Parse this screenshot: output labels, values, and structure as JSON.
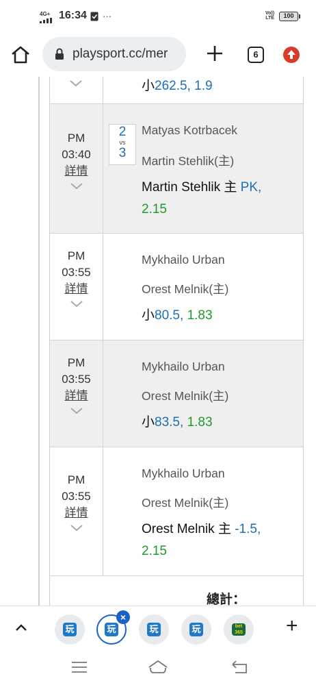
{
  "status_bar": {
    "network": "4G+",
    "time": "16:34",
    "volte": "Vo))\nLTE",
    "battery": "100",
    "more_dots": "···"
  },
  "browser": {
    "url": "playsport.cc/mer",
    "tab_count": "6"
  },
  "partial_row": {
    "bet_prefix": "小",
    "bet_line": "262.5,",
    "bet_odds": "1.9"
  },
  "matches": [
    {
      "ampm": "PM",
      "time": "03:40",
      "detail_label": "詳情",
      "score_top": "2",
      "vs_label": "vs",
      "score_bottom": "3",
      "away": "Matyas Kotrbacek",
      "home": "Martin Stehlik(主)",
      "bet_pick": "Martin Stehlik 主 ",
      "bet_line": "PK,",
      "bet_odds": "2.15",
      "colors": {
        "background": "#efefef"
      }
    },
    {
      "ampm": "PM",
      "time": "03:55",
      "detail_label": "詳情",
      "away": "Mykhailo Urban",
      "home": "Orest Melnik(主)",
      "bet_pick": "小",
      "bet_line": "80.5,",
      "bet_odds": "1.83",
      "colors": {
        "background": "#ffffff"
      }
    },
    {
      "ampm": "PM",
      "time": "03:55",
      "detail_label": "詳情",
      "away": "Mykhailo Urban",
      "home": "Orest Melnik(主)",
      "bet_pick": "小",
      "bet_line": "83.5,",
      "bet_odds": "1.83",
      "colors": {
        "background": "#efefef"
      }
    },
    {
      "ampm": "PM",
      "time": "03:55",
      "detail_label": "詳情",
      "away": "Mykhailo Urban",
      "home": "Orest Melnik(主)",
      "bet_pick": "Orest Melnik 主 ",
      "bet_line": "-1.5,",
      "bet_odds": "2.15",
      "colors": {
        "background": "#ffffff"
      }
    }
  ],
  "total_label": "總計：",
  "bottom_bar": {
    "tab_glyph": "玩",
    "close_glyph": "×",
    "bet_logo": "bet\n365",
    "plus": "+"
  },
  "colors": {
    "line_blue": "#1a6fb8",
    "odds_green": "#1e9a2a",
    "accent_red": "#d93b2b",
    "active_tab_blue": "#1a62c7"
  }
}
